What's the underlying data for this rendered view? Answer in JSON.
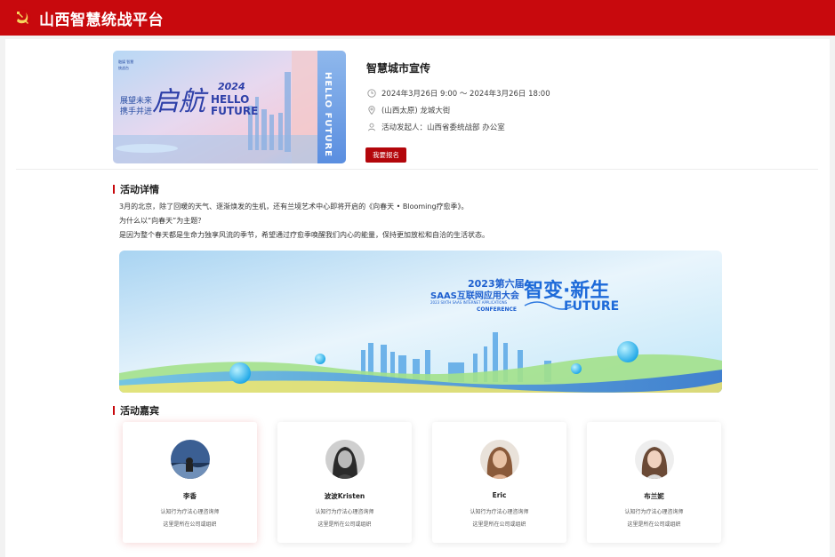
{
  "header": {
    "title": "山西智慧统战平台",
    "emblem_icon": "party-emblem-icon",
    "color": "#c8090d"
  },
  "event": {
    "cover": {
      "small_text_1": "融媒 智慧",
      "small_text_2": "统战台",
      "slogan_1": "展望未来",
      "slogan_2": "携手并进",
      "calligraphy": "启航",
      "year": "2024",
      "hello": "HELLO",
      "future": "FUTURE",
      "vertical": "HELLO FUTURE"
    },
    "title": "智慧城市宣传",
    "time": "2024年3月26日 9:00 ～ 2024年3月26日 18:00",
    "location": "(山西太原) 龙城大街",
    "organizer": "活动发起人：山西省委统战部 办公室",
    "signup_label": "我要报名"
  },
  "details": {
    "heading": "活动详情",
    "paragraphs": [
      "3月的北京，除了回暖的天气、逐渐焕发的生机，还有兰境艺术中心即将开启的《向春天 • Blooming疗愈季》。",
      "为什么以“向春天”为主题？",
      "是因为整个春天都是生命力独享风流的季节，希望通过疗愈季唤醒我们内心的能量，保持更加放松和自洽的生活状态。"
    ],
    "banner": {
      "line1": "2023第六届",
      "line2": "SAAS互联网应用大会",
      "line3": "2023 SIXTH SAAS INTERNET APPLICATIONS",
      "line4": "CONFERENCE",
      "big": "智变·新生",
      "future": "FUTURE"
    }
  },
  "guests": {
    "heading": "活动嘉宾",
    "items": [
      {
        "name": "李香",
        "line1": "认知行为疗法心理咨询师",
        "line2": "这里是所在公司或组织"
      },
      {
        "name": "波波Kristen",
        "line1": "认知行为疗法心理咨询师",
        "line2": "这里是所在公司或组织"
      },
      {
        "name": "Eric",
        "line1": "认知行为疗法心理咨询师",
        "line2": "这里是所在公司或组织"
      },
      {
        "name": "布兰妮",
        "line1": "认知行为疗法心理咨询师",
        "line2": "这里是所在公司或组织"
      }
    ]
  }
}
